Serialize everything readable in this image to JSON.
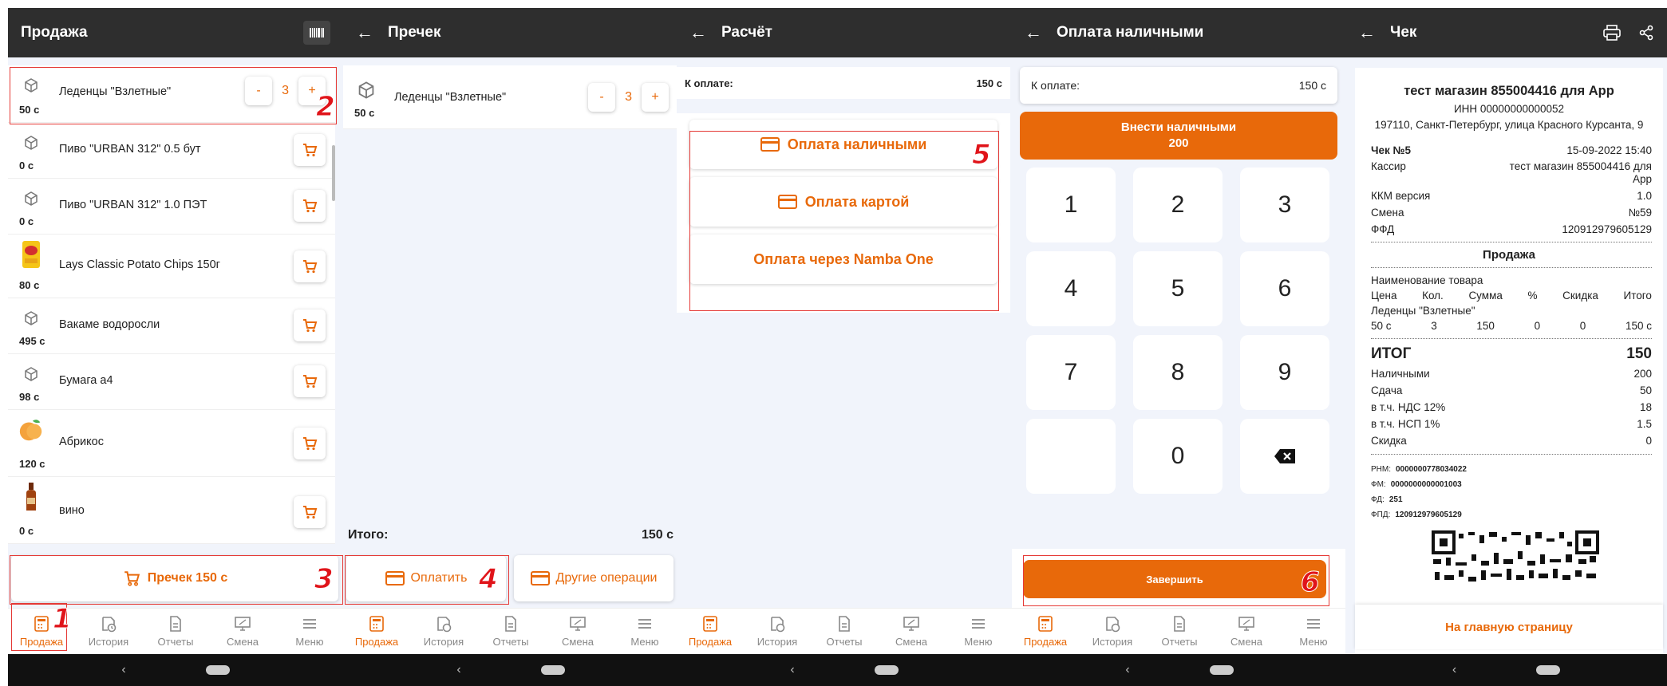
{
  "nav_tabs": [
    "Продажа",
    "История",
    "Отчеты",
    "Смена",
    "Меню"
  ],
  "screen1": {
    "title": "Продажа",
    "products": [
      {
        "name": "Леденцы \"Взлетные\"",
        "price": "50 с",
        "qty": "3",
        "minus": "-",
        "plus": "+"
      },
      {
        "name": "Пиво \"URBAN 312\" 0.5 бут",
        "price": "0 с"
      },
      {
        "name": "Пиво \"URBAN 312\" 1.0 ПЭТ",
        "price": "0 с"
      },
      {
        "name": "Lays Classic Potato Chips 150г",
        "price": "80 с"
      },
      {
        "name": "Вакаме водоросли",
        "price": "495 с"
      },
      {
        "name": "Бумага а4",
        "price": "98 с"
      },
      {
        "name": "Абрикос",
        "price": "120 с"
      },
      {
        "name": "вино",
        "price": "0 с"
      }
    ],
    "cart_button": "Пречек 150 с"
  },
  "screen2": {
    "title": "Пречек",
    "item": {
      "name": "Леденцы \"Взлетные\"",
      "price": "50 с",
      "qty": "3",
      "minus": "-",
      "plus": "+"
    },
    "total_label": "Итого:",
    "total_value": "150 с",
    "pay_button": "Оплатить",
    "other_button": "Другие операции"
  },
  "screen3": {
    "title": "Расчёт",
    "due_label": "К оплате:",
    "due_value": "150 с",
    "options": [
      "Оплата наличными",
      "Оплата картой",
      "Оплата через Namba One"
    ]
  },
  "screen4": {
    "title": "Оплата наличными",
    "due_label": "К оплате:",
    "due_value": "150 с",
    "deposit_label": "Внести наличными",
    "deposit_value": "200",
    "keys": [
      "1",
      "2",
      "3",
      "4",
      "5",
      "6",
      "7",
      "8",
      "9",
      "",
      "0"
    ],
    "finish_button": "Завершить"
  },
  "screen5": {
    "title": "Чек",
    "store": "тест магазин 855004416 для App",
    "inn": "ИНН 00000000000052",
    "address": "197110, Санкт-Петербург, улица Красного Курсанта, 9",
    "check_no": "Чек №5",
    "check_date": "15-09-2022 15:40",
    "cashier_label": "Кассир",
    "cashier_value1": "тест магазин 855004416 для",
    "cashier_value2": "App",
    "kkm_label": "ККМ версия",
    "kkm_value": "1.0",
    "shift_label": "Смена",
    "shift_value": "№59",
    "ffd_label": "ФФД",
    "ffd_value": "120912979605129",
    "section": "Продажа",
    "goods_header": "Наименование товара",
    "cols": [
      "Цена",
      "Кол.",
      "Сумма",
      "%",
      "Скидка",
      "Итого"
    ],
    "item_name": "Леденцы \"Взлетные\"",
    "item_vals": [
      "50 с",
      "3",
      "150",
      "0",
      "0",
      "150 с"
    ],
    "total_label": "ИТОГ",
    "total_value": "150",
    "rows": [
      {
        "label": "Наличными",
        "value": "200"
      },
      {
        "label": "Сдача",
        "value": "50"
      },
      {
        "label": "в т.ч. НДС 12%",
        "value": "18"
      },
      {
        "label": "в т.ч. НСП 1%",
        "value": "1.5"
      },
      {
        "label": "Скидка",
        "value": "0"
      }
    ],
    "fiscal": [
      {
        "label": "РНМ:",
        "value": "0000000778034022"
      },
      {
        "label": "ФМ:",
        "value": "0000000000001003"
      },
      {
        "label": "ФД:",
        "value": "251"
      },
      {
        "label": "ФПД:",
        "value": "120912979605129"
      }
    ],
    "home_button": "На главную страницу"
  },
  "markers": [
    "1",
    "2",
    "3",
    "4",
    "5",
    "6"
  ],
  "colors": {
    "accent": "#e8690a",
    "appbar": "#2e2e2e",
    "marker": "#e0141a"
  }
}
